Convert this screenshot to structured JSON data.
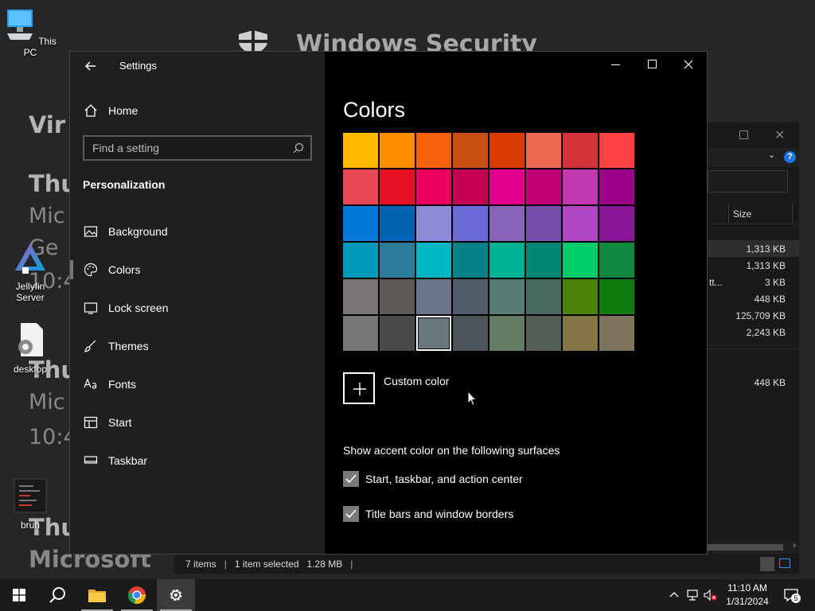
{
  "desktop": {
    "background_title": "Windows Security",
    "background_lines": [
      "Vir",
      "Thu",
      "Mic",
      "Ge",
      "10:4",
      "Thu",
      "Mic",
      "10:4",
      "Thu",
      "Microsoft"
    ],
    "icons": [
      {
        "label": "This PC",
        "icon": "computer-icon"
      },
      {
        "label": "Jellyfin Server",
        "icon": "jellyfin-icon"
      },
      {
        "label": "desktop",
        "icon": "settings-file-icon"
      },
      {
        "label": "bruh",
        "icon": "document-icon"
      }
    ]
  },
  "explorer": {
    "column_size": "Size",
    "rows": [
      {
        "name": "",
        "size": "1,313 KB"
      },
      {
        "name": "",
        "size": "1,313 KB"
      },
      {
        "name": "tt...",
        "size": "3 KB"
      },
      {
        "name": "",
        "size": "448 KB"
      },
      {
        "name": "",
        "size": "125,709 KB"
      },
      {
        "name": "",
        "size": "2,243 KB"
      },
      {
        "name": "",
        "size": ""
      },
      {
        "name": "",
        "size": "448 KB"
      }
    ],
    "status": {
      "items": "7 items",
      "selected": "1 item selected",
      "size": "1.28 MB"
    }
  },
  "settings": {
    "window_title": "Settings",
    "home_label": "Home",
    "search_placeholder": "Find a setting",
    "section": "Personalization",
    "nav": [
      {
        "label": "Background",
        "icon": "picture-icon",
        "active": false
      },
      {
        "label": "Colors",
        "icon": "palette-icon",
        "active": true
      },
      {
        "label": "Lock screen",
        "icon": "lock-screen-icon",
        "active": false
      },
      {
        "label": "Themes",
        "icon": "brush-icon",
        "active": false
      },
      {
        "label": "Fonts",
        "icon": "font-icon",
        "active": false
      },
      {
        "label": "Start",
        "icon": "start-icon",
        "active": false
      },
      {
        "label": "Taskbar",
        "icon": "taskbar-icon",
        "active": false
      }
    ],
    "page_title": "Colors",
    "palette": [
      "#FFB900",
      "#FF8C00",
      "#F7630C",
      "#CA5010",
      "#DA3B01",
      "#EF6950",
      "#D13438",
      "#FF4343",
      "#E74856",
      "#E81123",
      "#EA005E",
      "#C30052",
      "#E3008C",
      "#BF0077",
      "#C239B3",
      "#9A0089",
      "#0078D7",
      "#0063B1",
      "#8E8CD8",
      "#6B69D6",
      "#8764B8",
      "#744DA9",
      "#B146C2",
      "#881798",
      "#0099BC",
      "#2D7D9A",
      "#00B7C3",
      "#038387",
      "#00B294",
      "#018574",
      "#00CC6A",
      "#10893E",
      "#7A7574",
      "#5D5A58",
      "#68768A",
      "#515C6B",
      "#567C73",
      "#486860",
      "#498205",
      "#107C10",
      "#767676",
      "#4C4A48",
      "#69797E",
      "#4A5459",
      "#647C64",
      "#525E54",
      "#847545",
      "#7E735F"
    ],
    "selected_index": 42,
    "custom_color_label": "Custom color",
    "surfaces_heading": "Show accent color on the following surfaces",
    "checkboxes": [
      {
        "label": "Start, taskbar, and action center",
        "checked": true
      },
      {
        "label": "Title bars and window borders",
        "checked": true
      }
    ]
  },
  "taskbar": {
    "time": "11:10 AM",
    "date": "1/31/2024",
    "notification_count": "5"
  }
}
